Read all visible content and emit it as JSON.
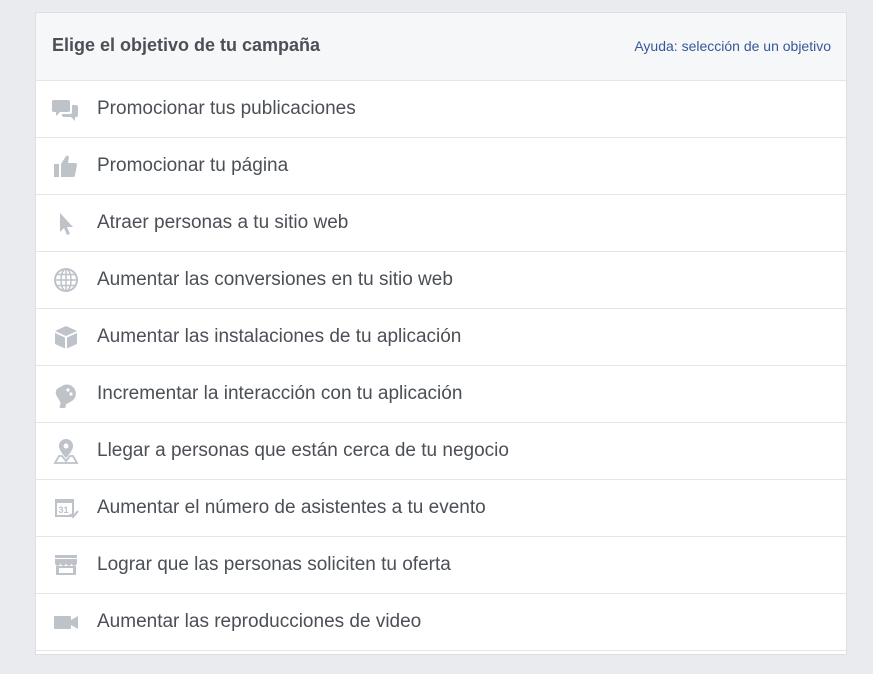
{
  "header": {
    "title": "Elige el objetivo de tu campaña",
    "help_link": "Ayuda: selección de un objetivo"
  },
  "objectives": [
    {
      "label": "Promocionar tus publicaciones",
      "icon": "speech-bubbles-icon"
    },
    {
      "label": "Promocionar tu página",
      "icon": "thumbs-up-icon"
    },
    {
      "label": "Atraer personas a tu sitio web",
      "icon": "cursor-icon"
    },
    {
      "label": "Aumentar las conversiones en tu sitio web",
      "icon": "globe-icon"
    },
    {
      "label": "Aumentar las instalaciones de tu aplicación",
      "icon": "box-icon"
    },
    {
      "label": "Incrementar la interacción con tu aplicación",
      "icon": "gamepad-icon"
    },
    {
      "label": "Llegar a personas que están cerca de tu negocio",
      "icon": "location-pin-icon"
    },
    {
      "label": "Aumentar el número de asistentes a tu evento",
      "icon": "calendar-icon"
    },
    {
      "label": "Lograr que las personas soliciten tu oferta",
      "icon": "storefront-icon"
    },
    {
      "label": "Aumentar las reproducciones de video",
      "icon": "video-camera-icon"
    }
  ],
  "colors": {
    "icon": "#bec2c9",
    "text": "#4b4f56",
    "link": "#365899",
    "header_bg": "#f6f7f9",
    "page_bg": "#e9ebee"
  }
}
